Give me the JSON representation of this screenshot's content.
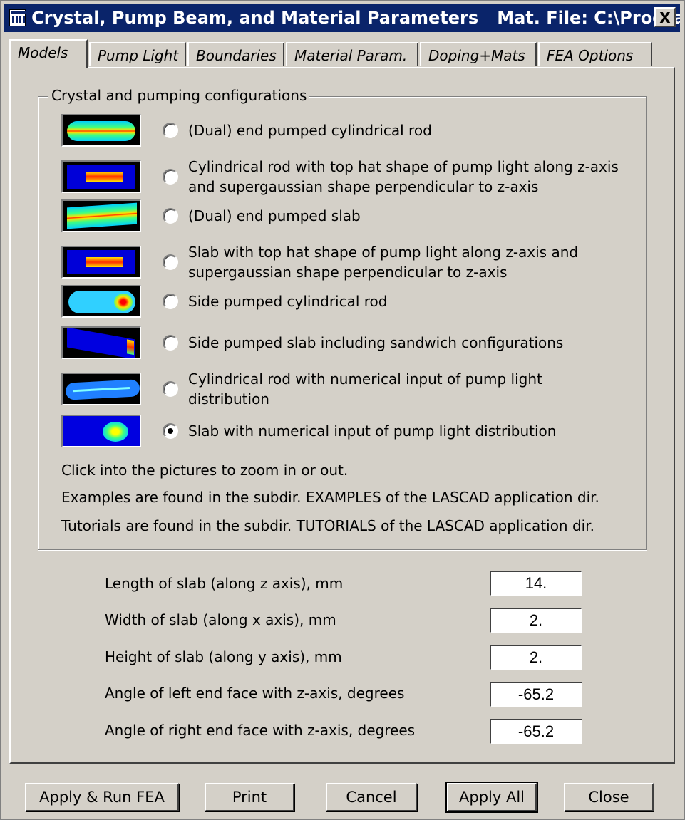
{
  "window": {
    "title": "Crystal, Pump Beam, and Material Parameters",
    "file": "Mat. File: C:\\Program...",
    "close_label": "X"
  },
  "tabs": [
    {
      "label": "Models",
      "active": true
    },
    {
      "label": "Pump Light"
    },
    {
      "label": "Boundaries"
    },
    {
      "label": "Material Param."
    },
    {
      "label": "Doping+Mats"
    },
    {
      "label": "FEA Options"
    }
  ],
  "group": {
    "title": "Crystal and pumping configurations",
    "options": [
      {
        "label": "(Dual) end pumped cylindrical rod",
        "icon": "end-pumped-rod-thumbnail"
      },
      {
        "label": "Cylindrical rod with top hat shape of pump light along z-axis and supergaussian shape perpendicular to z-axis",
        "icon": "tophat-rod-thumbnail"
      },
      {
        "label": "(Dual) end pumped slab",
        "icon": "end-pumped-slab-thumbnail"
      },
      {
        "label": "Slab with top hat shape of pump light along z-axis and supergaussian shape perpendicular to z-axis",
        "icon": "tophat-slab-thumbnail"
      },
      {
        "label": "Side pumped cylindrical rod",
        "icon": "side-pumped-rod-thumbnail"
      },
      {
        "label": "Side pumped slab including sandwich configurations",
        "icon": "side-pumped-slab-thumbnail"
      },
      {
        "label": "Cylindrical rod with numerical input of pump light distribution",
        "icon": "numerical-rod-thumbnail"
      },
      {
        "label": "Slab with numerical input of pump light distribution",
        "icon": "numerical-slab-thumbnail",
        "selected": true
      }
    ],
    "info": [
      "Click into the pictures to zoom in or out.",
      "Examples are found in the subdir. EXAMPLES of the LASCAD application dir.",
      "Tutorials are found in the subdir. TUTORIALS of the LASCAD application dir."
    ]
  },
  "params": [
    {
      "label": "Length of slab (along z axis), mm",
      "value": "14."
    },
    {
      "label": "Width of slab (along x axis), mm",
      "value": "2."
    },
    {
      "label": "Height of slab (along y axis), mm",
      "value": "2."
    },
    {
      "label": "Angle of left end face with z-axis, degrees",
      "value": "-65.2"
    },
    {
      "label": "Angle of right end face with z-axis, degrees",
      "value": "-65.2"
    }
  ],
  "buttons": {
    "apply_run": "Apply  &  Run FEA",
    "print": "Print",
    "cancel": "Cancel",
    "apply_all": "Apply All",
    "close": "Close"
  }
}
